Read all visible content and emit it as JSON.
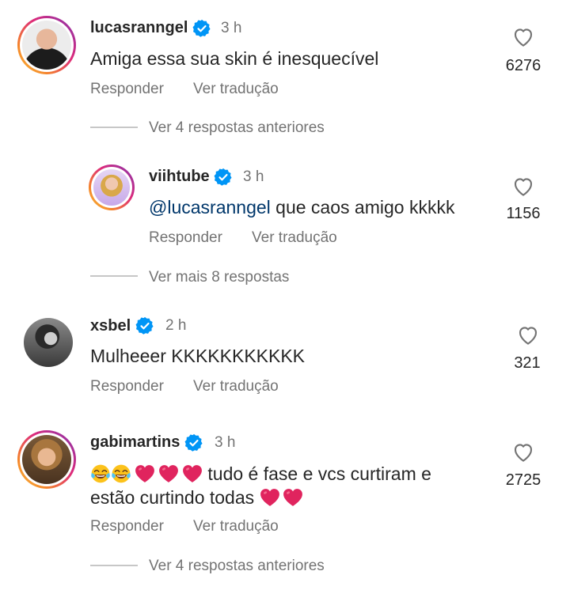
{
  "comments": [
    {
      "username": "lucasranngel",
      "time": "3 h",
      "text": "Amiga essa sua skin é inesquecível",
      "likes": "6276",
      "reply_label": "Responder",
      "translate_label": "Ver tradução",
      "view_more": "Ver 4 respostas anteriores"
    },
    {
      "username": "viihtube",
      "time": "3 h",
      "mention": "@lucasranngel",
      "text": " que caos amigo kkkkk",
      "likes": "1156",
      "reply_label": "Responder",
      "translate_label": "Ver tradução",
      "view_more": "Ver mais 8 respostas"
    },
    {
      "username": "xsbel",
      "time": "2 h",
      "text": "Mulheeer KKKKKKKKKKK",
      "likes": "321",
      "reply_label": "Responder",
      "translate_label": "Ver tradução"
    },
    {
      "username": "gabimartins",
      "time": "3 h",
      "text_line1": " tudo é fase e vcs curtiram e",
      "text_line2": "estão curtindo todas ",
      "likes": "2725",
      "reply_label": "Responder",
      "translate_label": "Ver tradução",
      "view_more": "Ver 4 respostas anteriores"
    }
  ],
  "icons": {
    "heart": "heart-outline-icon",
    "verified": "verified-badge-icon",
    "red_heart_emoji": "red-heart-emoji",
    "laughing_emoji": "tears-of-joy-emoji"
  },
  "colors": {
    "verified": "#0095f6",
    "secondary_text": "#737373",
    "mention": "#00376b",
    "heart_emoji": "#e0245e"
  }
}
